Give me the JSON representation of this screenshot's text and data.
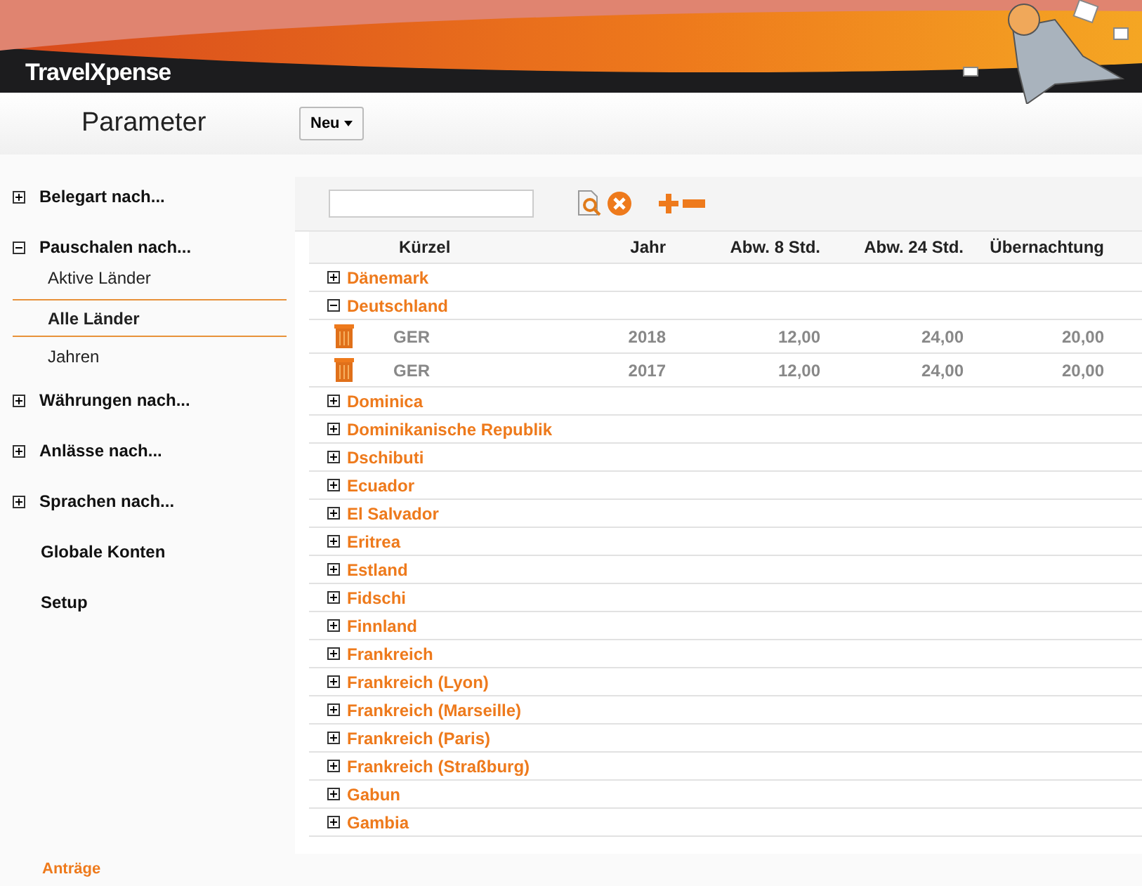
{
  "header": {
    "logo": "TravelXpense"
  },
  "toolbar": {
    "title": "Parameter",
    "new_button": "Neu"
  },
  "sidebar": {
    "items": [
      {
        "kind": "group",
        "label": "Belegart nach...",
        "expanded": false
      },
      {
        "kind": "group",
        "label": "Pauschalen nach...",
        "expanded": true,
        "children": [
          {
            "label": "Aktive Länder",
            "selected": false
          },
          {
            "label": "Alle Länder",
            "selected": true
          },
          {
            "label": "Jahren",
            "selected": false
          }
        ]
      },
      {
        "kind": "group",
        "label": "Währungen nach...",
        "expanded": false
      },
      {
        "kind": "group",
        "label": "Anlässe nach...",
        "expanded": false
      },
      {
        "kind": "group",
        "label": "Sprachen nach...",
        "expanded": false
      },
      {
        "kind": "link",
        "label": "Globale Konten"
      },
      {
        "kind": "link",
        "label": "Setup"
      }
    ],
    "footer": "Anträge"
  },
  "table": {
    "columns": [
      "Kürzel",
      "Jahr",
      "Abw. 8 Std.",
      "Abw. 24 Std.",
      "Übernachtung"
    ],
    "groups": [
      {
        "name": "Dänemark",
        "expanded": false
      },
      {
        "name": "Deutschland",
        "expanded": true,
        "rows": [
          [
            "GER",
            "2018",
            "12,00",
            "24,00",
            "20,00"
          ],
          [
            "GER",
            "2017",
            "12,00",
            "24,00",
            "20,00"
          ]
        ]
      },
      {
        "name": "Dominica",
        "expanded": false
      },
      {
        "name": "Dominikanische Republik",
        "expanded": false
      },
      {
        "name": "Dschibuti",
        "expanded": false
      },
      {
        "name": "Ecuador",
        "expanded": false
      },
      {
        "name": "El Salvador",
        "expanded": false
      },
      {
        "name": "Eritrea",
        "expanded": false
      },
      {
        "name": "Estland",
        "expanded": false
      },
      {
        "name": "Fidschi",
        "expanded": false
      },
      {
        "name": "Finnland",
        "expanded": false
      },
      {
        "name": "Frankreich",
        "expanded": false
      },
      {
        "name": "Frankreich (Lyon)",
        "expanded": false
      },
      {
        "name": "Frankreich (Marseille)",
        "expanded": false
      },
      {
        "name": "Frankreich (Paris)",
        "expanded": false
      },
      {
        "name": "Frankreich (Straßburg)",
        "expanded": false
      },
      {
        "name": "Gabun",
        "expanded": false
      },
      {
        "name": "Gambia",
        "expanded": false
      }
    ]
  }
}
